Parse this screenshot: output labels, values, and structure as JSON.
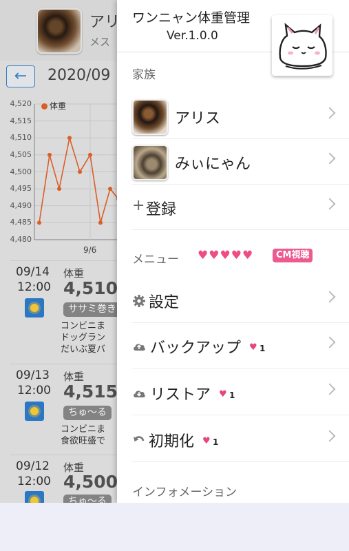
{
  "background": {
    "pet_name": "アリ",
    "pet_subtitle": "メス",
    "back_label": "←",
    "month": "2020/09",
    "entries": [
      {
        "date": "09/14",
        "time": "12:00",
        "label": "体重",
        "weight": "4,510",
        "tag": "ササミ巻き",
        "memo": "コンビニま\nドッグラン\nだいぶ夏バ"
      },
      {
        "date": "09/13",
        "time": "12:00",
        "label": "体重",
        "weight": "4,515",
        "tag": "ちゅ〜る",
        "memo": "コンビニま\n食欲旺盛で"
      },
      {
        "date": "09/12",
        "time": "12:00",
        "label": "体重",
        "weight": "4,500",
        "tag": "ちゅ〜る",
        "memo": ""
      }
    ]
  },
  "chart_data": {
    "type": "line",
    "title": "",
    "xlabel": "",
    "ylabel": "",
    "legend": "体重",
    "ylim": [
      4480,
      4520
    ],
    "y_ticks": [
      "4,520",
      "4,515",
      "4,510",
      "4,505",
      "4,500",
      "4,495",
      "4,490",
      "4,485",
      "4,480"
    ],
    "x_tick_labels": [
      "9/6"
    ],
    "series": [
      {
        "name": "体重",
        "values": [
          4485,
          4505,
          4495,
          4510,
          4500,
          4505,
          4485,
          4495,
          4492
        ]
      }
    ],
    "color": "#e8642a"
  },
  "drawer": {
    "app_title": "ワンニャン体重管理",
    "version": "Ver.1.0.0",
    "family_header": "家族",
    "pets": [
      {
        "name": "アリス"
      },
      {
        "name": "みぃにゃん"
      }
    ],
    "register_label": "登録",
    "register_prefix": "+",
    "menu_header": "メニュー",
    "menu_hearts": "♥♥♥♥♥",
    "cm_badge": "CM視聴",
    "menu_items": [
      {
        "label": "設定",
        "hearts": ""
      },
      {
        "label": "バックアップ",
        "hearts": "1"
      },
      {
        "label": "リストア",
        "hearts": "1"
      },
      {
        "label": "初期化",
        "hearts": "1"
      }
    ],
    "info_header": "インフォメーション"
  }
}
